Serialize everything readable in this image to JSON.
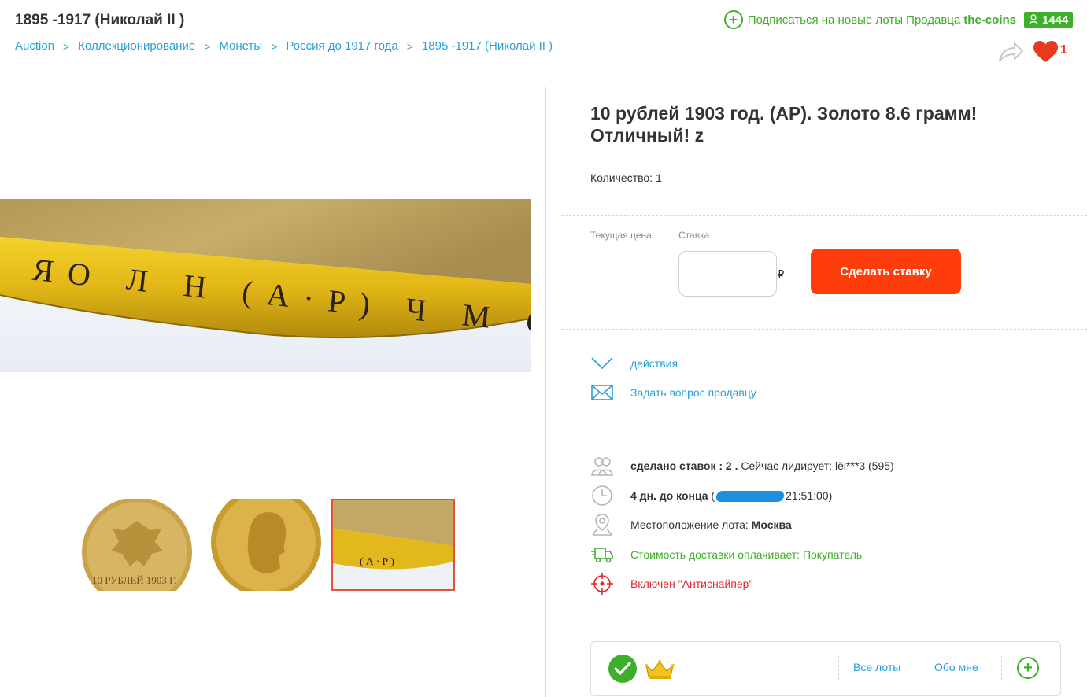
{
  "header": {
    "title": "1895 -1917 (Николай II )",
    "breadcrumbs": [
      "Auction",
      "Коллекционирование",
      "Монеты",
      "Россия до 1917 года",
      "1895 -1917 (Николай II )"
    ],
    "breadcrumb_separator": ">",
    "subscribe_text": "Подписаться на новые лоты Продавца",
    "seller_name": "the-coins",
    "seller_rating": "1444",
    "favorites_count": "1"
  },
  "gallery": {
    "main_image": "coin-edge-closeup",
    "main_image_lettering": "ЯО Л Н (А·Р) Ч М С Т",
    "thumbnails": [
      {
        "name": "coin-reverse-eagle",
        "caption": "10 РУБЛЕЙ 1903 Г.",
        "active": false
      },
      {
        "name": "coin-obverse-portrait",
        "caption": "",
        "active": false
      },
      {
        "name": "coin-edge-closeup",
        "caption": "(А·Р)",
        "active": true
      }
    ]
  },
  "lot": {
    "title": "10 рублей 1903 год. (АР). Золото 8.6 грамм! Отличный! z",
    "quantity_label": "Количество:",
    "quantity_value": "1"
  },
  "bidding": {
    "current_price_label": "Текущая цена",
    "current_price_value": "",
    "bid_label": "Ставка",
    "bid_placeholder": "",
    "currency_symbol": "₽",
    "bid_button_label": "Сделать ставку",
    "button_color": "#ff3d0c"
  },
  "actions": {
    "actions_label": "действия",
    "ask_seller_label": "Задать вопрос продавцу"
  },
  "info": {
    "bids_bold": "сделано ставок : 2 .",
    "bids_leader_text": "Сейчас лидирует: lёl***3 (595)",
    "time_left_bold": "4 дн. до конца",
    "time_end_prefix": "(",
    "time_end_suffix": "21:51:00)",
    "location_label": "Местоположение лота:",
    "location_value": "Москва",
    "delivery_text": "Стоимость доставки оплачивает: Покупатель",
    "antisniper_text": "Включен \"Антиснайпер\""
  },
  "seller_card": {
    "all_lots_label": "Все лоты",
    "about_label": "Обо мне"
  },
  "colors": {
    "link": "#2a9fd6",
    "green": "#3fae2a",
    "red": "#e0262b",
    "accent": "#ff3d0c"
  }
}
